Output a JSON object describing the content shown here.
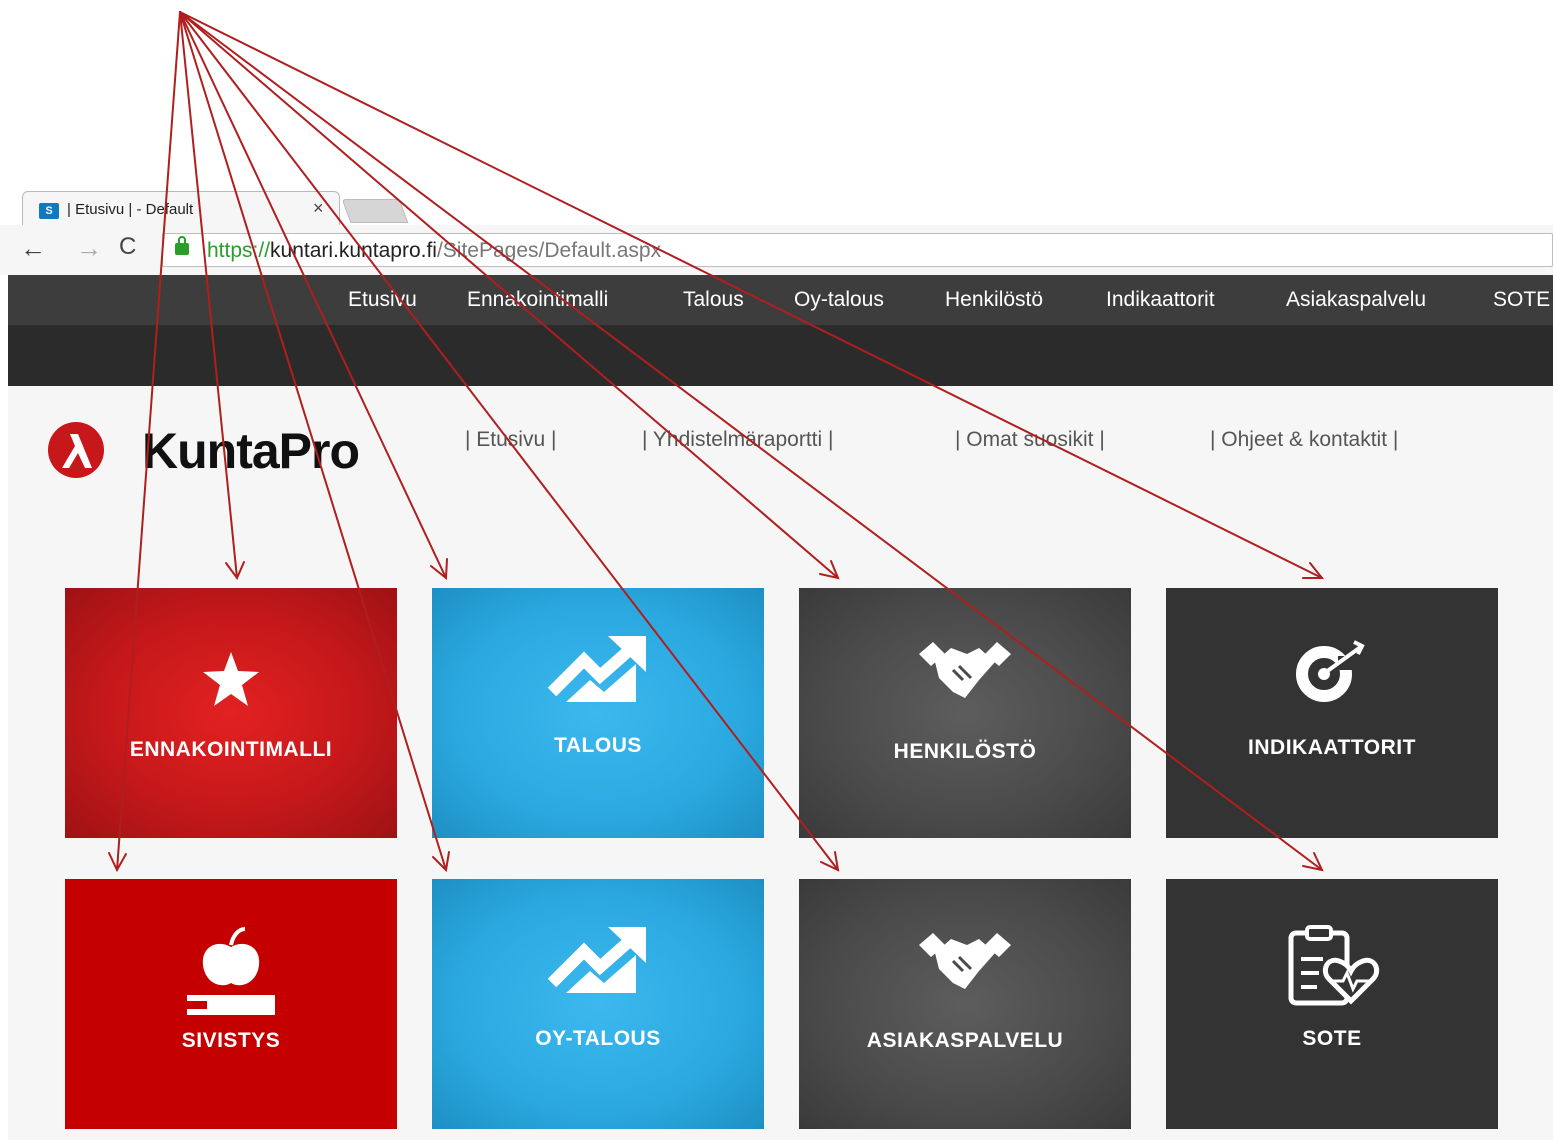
{
  "browser": {
    "tab": {
      "favicon": "S",
      "title": "| Etusivu | - Default",
      "close": "×"
    },
    "nav": {
      "back": "←",
      "forward": "→",
      "reload": "C"
    },
    "url": {
      "scheme": "https://",
      "host": "kuntari.kuntapro.fi",
      "path": "/SitePages/Default.aspx"
    }
  },
  "top_nav": [
    "Etusivu",
    "Ennakointimalli",
    "Talous",
    "Oy-talous",
    "Henkilöstö",
    "Indikaattorit",
    "Asiakaspalvelu",
    "SOTE"
  ],
  "logo_text": "KuntaPro",
  "sub_links": [
    "| Etusivu |",
    "| Yhdistelmäraportti |",
    "| Omat suosikit |",
    "| Ohjeet & kontaktit |"
  ],
  "tiles": [
    {
      "label": "ENNAKOINTIMALLI",
      "icon": "star-icon"
    },
    {
      "label": "TALOUS",
      "icon": "trend-up-icon"
    },
    {
      "label": "HENKILÖSTÖ",
      "icon": "handshake-icon"
    },
    {
      "label": "INDIKAATTORIT",
      "icon": "target-icon"
    },
    {
      "label": "SIVISTYS",
      "icon": "apple-book-icon"
    },
    {
      "label": "OY-TALOUS",
      "icon": "trend-up-icon"
    },
    {
      "label": "ASIAKASPALVELU",
      "icon": "handshake-icon"
    },
    {
      "label": "SOTE",
      "icon": "clipboard-heart-icon"
    }
  ],
  "annotation": {
    "arrow_color": "#b01e1e",
    "arrow_count": 8
  },
  "colors": {
    "red": "#c5181a",
    "blue": "#2aa9e0",
    "gray": "#4a4a4a",
    "dark": "#333333",
    "nav": "#3d3d3d"
  }
}
